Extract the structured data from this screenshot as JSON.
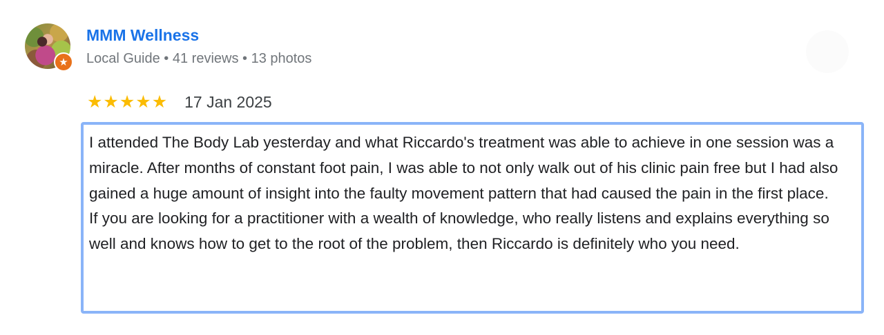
{
  "author": {
    "name": "MMM Wellness",
    "meta": "Local Guide • 41 reviews • 13 photos",
    "badge_icon": "★"
  },
  "rating": {
    "stars": 5,
    "star_glyph": "★",
    "date": "17 Jan 2025"
  },
  "review": {
    "text": "I attended The Body Lab yesterday and what Riccardo's treatment was able to achieve in one session was a miracle. After months of constant foot pain, I was able to not only walk out of his clinic pain free but I had also gained a huge amount of insight into the faulty movement pattern that had caused the pain in the first place.\nIf you are looking for a practitioner with a wealth of knowledge, who really listens and explains everything so well and knows how to get to the root of the problem, then Riccardo is definitely who you need."
  },
  "colors": {
    "name": "#1a73e8",
    "star": "#fbbc04",
    "badge": "#e8711a",
    "selection_border": "#8ab4f8"
  }
}
